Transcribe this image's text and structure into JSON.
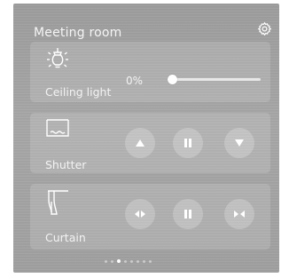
{
  "room": {
    "title": "Meeting room",
    "settings_icon": "gear-icon"
  },
  "devices": {
    "light": {
      "label": "Ceiling light",
      "icon": "ceiling-light-icon",
      "level_text": "0%",
      "level": 0
    },
    "shutter": {
      "label": "Shutter",
      "icon": "shutter-icon",
      "controls": [
        "up-arrow-icon",
        "pause-icon",
        "down-arrow-icon"
      ]
    },
    "curtain": {
      "label": "Curtain",
      "icon": "curtain-icon",
      "controls": [
        "open-curtain-icon",
        "pause-icon",
        "close-curtain-icon"
      ]
    }
  },
  "pagination": {
    "count": 8,
    "active_index": 2
  },
  "colors": {
    "panel": "#a0a0a0",
    "text": "#ffffff"
  }
}
